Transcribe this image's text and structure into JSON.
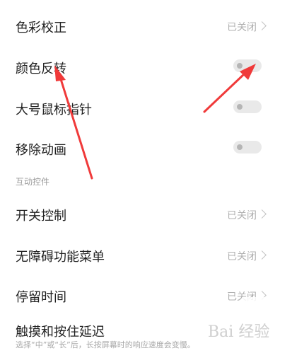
{
  "settings": {
    "rows": [
      {
        "label": "色彩校正",
        "value": "已关闭",
        "type": "chevron"
      },
      {
        "label": "颜色反转",
        "type": "toggle",
        "on": false
      },
      {
        "label": "大号鼠标指针",
        "type": "toggle",
        "on": false
      },
      {
        "label": "移除动画",
        "type": "toggle",
        "on": false
      }
    ],
    "section_title": "互动控件",
    "rows2": [
      {
        "label": "开关控制",
        "value": "已关闭",
        "type": "chevron"
      },
      {
        "label": "无障碍功能菜单",
        "value": "已关闭",
        "type": "chevron"
      },
      {
        "label": "停留时间",
        "value": "已关闭",
        "type": "chevron"
      },
      {
        "label": "触摸和按住延迟",
        "type": "plain"
      }
    ],
    "hint": "选择“中”或“长”后，长按屏幕时的响应速度会变慢。"
  },
  "watermark": {
    "text": "Bai 经验"
  },
  "colors": {
    "arrow": "#f03a3a",
    "toggle_off": "#e9e9e9"
  },
  "icons": [
    "chevron-right-icon",
    "toggle-switch",
    "annotation-arrow"
  ]
}
